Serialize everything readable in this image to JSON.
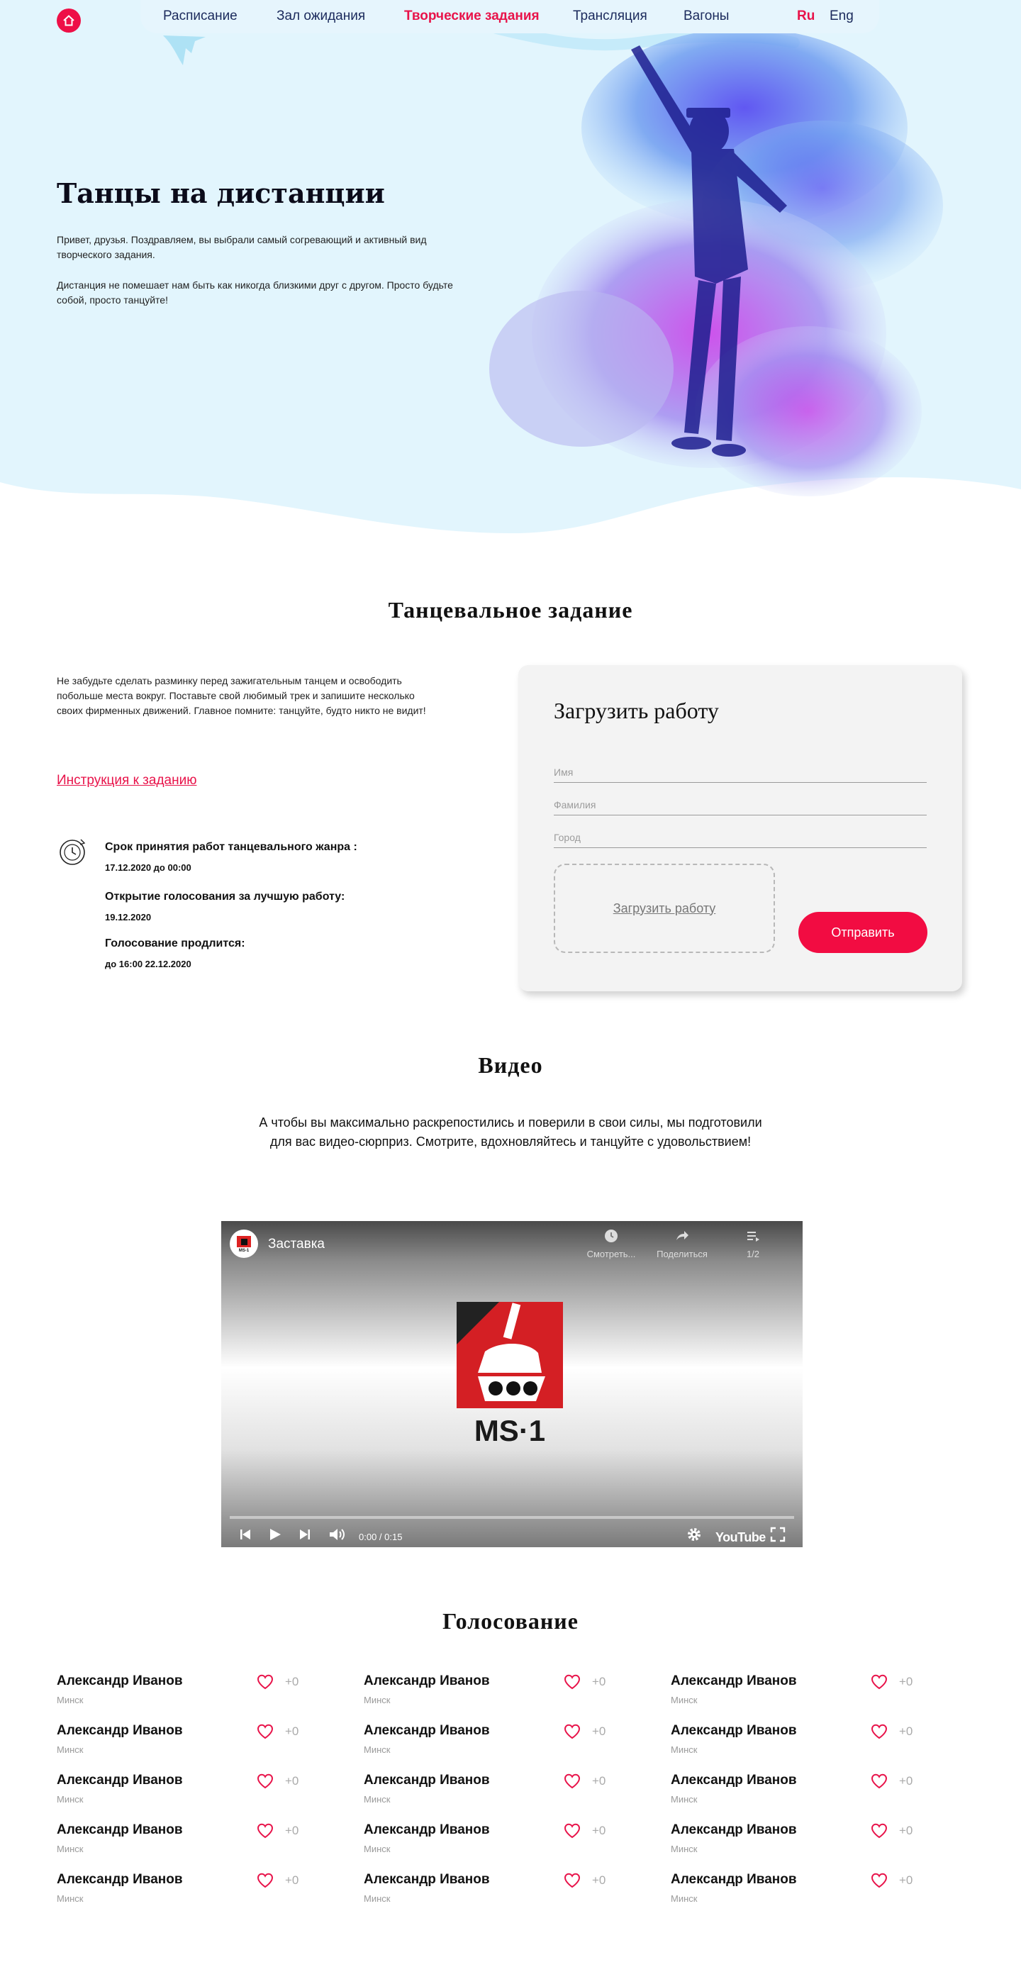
{
  "nav": {
    "home_icon": "home-icon",
    "items": [
      {
        "label": "Расписание",
        "active": false
      },
      {
        "label": "Зал ожидания",
        "active": false
      },
      {
        "label": "Творческие задания",
        "active": true
      },
      {
        "label": "Трансляция",
        "active": false
      },
      {
        "label": "Вагоны",
        "active": false
      }
    ],
    "langs": [
      {
        "label": "Ru",
        "active": true
      },
      {
        "label": "Eng",
        "active": false
      }
    ]
  },
  "hero": {
    "title": "Танцы на дистанции",
    "p1": "Привет, друзья. Поздравляем, вы выбрали самый согревающий и активный вид творческого задания.",
    "p2": "Дистанция не помешает нам быть как никогда близкими друг с другом. Просто будьте собой, просто танцуйте!"
  },
  "task": {
    "title": "Танцевальное задание",
    "text": "Не забудьте сделать разминку перед зажигательным танцем и освободить побольше места вокруг. Поставьте свой любимый трек и запишите несколько своих фирменных движений. Главное помните: танцуйте, будто никто не видит!",
    "instruction_link": "Инструкция к заданию",
    "deadlines": [
      {
        "head": "Срок принятия работ танцевального жанра :",
        "date": "17.12.2020 до 00:00"
      },
      {
        "head": "Открытие голосования за лучшую работу:",
        "date": "19.12.2020"
      },
      {
        "head": "Голосование продлится:",
        "date": "до 16:00 22.12.2020"
      }
    ]
  },
  "form": {
    "title": "Загрузить работу",
    "fields": [
      {
        "placeholder": "Имя",
        "value": ""
      },
      {
        "placeholder": "Фамилия",
        "value": ""
      },
      {
        "placeholder": "Город",
        "value": ""
      }
    ],
    "upload_label": "Загрузить работу",
    "submit_label": "Отправить"
  },
  "video": {
    "title": "Видео",
    "text": "А чтобы вы максимально раскрепостились и поверили в свои силы, мы подготовили для вас видео-сюрприз. Смотрите, вдохновляйтесь и танцуйте с удовольствием!",
    "player": {
      "video_title": "Заставка",
      "channel_logo_text": "MS-1",
      "watch_later_label": "Смотреть...",
      "share_label": "Поделиться",
      "playlist_label": "1/2",
      "time": "0:00 / 0:15",
      "logo_text": "MS·1",
      "youtube_label": "YouTube",
      "progress": 0
    }
  },
  "voting": {
    "title": "Голосование",
    "columns": [
      [
        {
          "name": "Александр Иванов",
          "city": "Минск",
          "count": "+0"
        },
        {
          "name": "Александр Иванов",
          "city": "Минск",
          "count": "+0"
        },
        {
          "name": "Александр Иванов",
          "city": "Минск",
          "count": "+0"
        },
        {
          "name": "Александр Иванов",
          "city": "Минск",
          "count": "+0"
        },
        {
          "name": "Александр Иванов",
          "city": "Минск",
          "count": "+0"
        }
      ],
      [
        {
          "name": "Александр Иванов",
          "city": "Минск",
          "count": "+0"
        },
        {
          "name": "Александр Иванов",
          "city": "Минск",
          "count": "+0"
        },
        {
          "name": "Александр Иванов",
          "city": "Минск",
          "count": "+0"
        },
        {
          "name": "Александр Иванов",
          "city": "Минск",
          "count": "+0"
        },
        {
          "name": "Александр Иванов",
          "city": "Минск",
          "count": "+0"
        }
      ],
      [
        {
          "name": "Александр Иванов",
          "city": "Минск",
          "count": "+0"
        },
        {
          "name": "Александр Иванов",
          "city": "Минск",
          "count": "+0"
        },
        {
          "name": "Александр Иванов",
          "city": "Минск",
          "count": "+0"
        },
        {
          "name": "Александр Иванов",
          "city": "Минск",
          "count": "+0"
        },
        {
          "name": "Александр Иванов",
          "city": "Минск",
          "count": "+0"
        }
      ]
    ]
  },
  "colors": {
    "accent": "#e8134a",
    "nav_text": "#1b2a5c",
    "hero_bg": "#e2f5fd"
  }
}
